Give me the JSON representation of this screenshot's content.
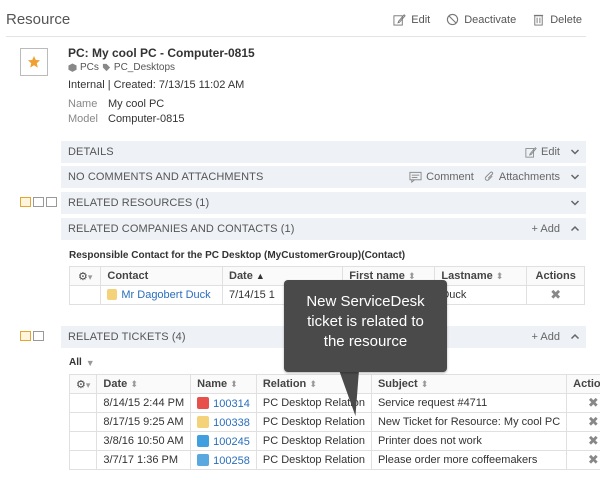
{
  "header": {
    "title": "Resource",
    "edit_label": "Edit",
    "deactivate_label": "Deactivate",
    "delete_label": "Delete"
  },
  "resource": {
    "name": "PC: My cool PC - Computer-0815",
    "category_1": "PCs",
    "category_2": "PC_Desktops",
    "meta": "Internal | Created: 7/13/15 11:02 AM",
    "fields": {
      "name_key": "Name",
      "name_value": "My cool PC",
      "model_key": "Model",
      "model_value": "Computer-0815"
    }
  },
  "sections": {
    "details": {
      "label": "DETAILS",
      "edit_label": "Edit"
    },
    "comments": {
      "label": "NO COMMENTS AND ATTACHMENTS",
      "comment_label": "Comment",
      "attachments_label": "Attachments"
    },
    "resources": {
      "label": "RELATED RESOURCES (1)"
    },
    "companies": {
      "label": "RELATED COMPANIES AND CONTACTS (1)",
      "add_label": "+ Add"
    },
    "tickets": {
      "label": "RELATED TICKETS (4)",
      "add_label": "+ Add"
    }
  },
  "contacts": {
    "subtitle": "Responsible Contact for the PC Desktop (MyCustomerGroup)(Contact)",
    "columns": [
      "Contact",
      "Date",
      "First name",
      "Lastname",
      "Actions"
    ],
    "row": {
      "contact": "Mr Dagobert Duck",
      "date": "7/14/15 1",
      "first": "",
      "last": "Duck"
    }
  },
  "tickets": {
    "filter_label": "All",
    "columns": [
      "Date",
      "Name",
      "Relation",
      "Subject",
      "Actions"
    ],
    "rows": [
      {
        "date": "8/14/15 2:44 PM",
        "name": "100314",
        "relation": "PC Desktop Relation",
        "subject": "Service request #4711"
      },
      {
        "date": "8/17/15 9:25 AM",
        "name": "100338",
        "relation": "PC Desktop Relation",
        "subject": "New Ticket for Resource: My cool PC"
      },
      {
        "date": "3/8/16 10:50 AM",
        "name": "100245",
        "relation": "PC Desktop Relation",
        "subject": "Printer does not work"
      },
      {
        "date": "3/7/17 1:36 PM",
        "name": "100258",
        "relation": "PC Desktop Relation",
        "subject": "Please order more coffeemakers"
      }
    ]
  },
  "tooltip": {
    "line1": "New ServiceDesk",
    "line2": "ticket is related to",
    "line3": "the resource"
  },
  "colors": {
    "section_bg": "#eef1f6",
    "link": "#2a6ebb",
    "star": "#f0a030",
    "tooltip_bg": "#4a4a4a"
  }
}
